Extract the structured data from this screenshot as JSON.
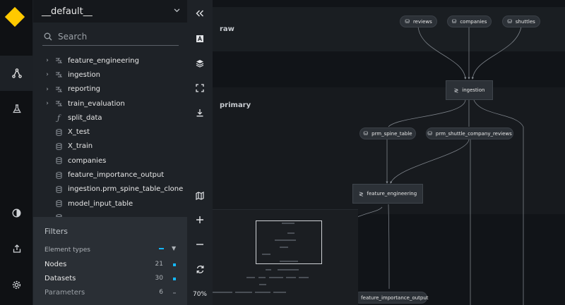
{
  "pipeline": {
    "name": "__default__"
  },
  "search": {
    "placeholder": "Search"
  },
  "tree": [
    {
      "label": "feature_engineering",
      "type": "modular",
      "expandable": true
    },
    {
      "label": "ingestion",
      "type": "modular",
      "expandable": true
    },
    {
      "label": "reporting",
      "type": "modular",
      "expandable": true
    },
    {
      "label": "train_evaluation",
      "type": "modular",
      "expandable": true
    },
    {
      "label": "split_data",
      "type": "task",
      "expandable": false
    },
    {
      "label": "X_test",
      "type": "dataset",
      "expandable": false
    },
    {
      "label": "X_train",
      "type": "dataset",
      "expandable": false
    },
    {
      "label": "companies",
      "type": "dataset",
      "expandable": false
    },
    {
      "label": "feature_importance_output",
      "type": "dataset",
      "expandable": false
    },
    {
      "label": "ingestion.prm_spine_table_clone",
      "type": "dataset",
      "expandable": false
    },
    {
      "label": "model_input_table",
      "type": "dataset",
      "expandable": false
    },
    {
      "label": "",
      "type": "dataset",
      "expandable": false
    }
  ],
  "filters": {
    "title": "Filters",
    "element_types": "Element types",
    "rows": [
      {
        "label": "Nodes",
        "count": "21",
        "enabled": true
      },
      {
        "label": "Datasets",
        "count": "30",
        "enabled": true
      },
      {
        "label": "Parameters",
        "count": "6",
        "enabled": false
      }
    ]
  },
  "toolbar": {
    "zoom": "70%"
  },
  "canvas": {
    "layers": {
      "raw": "raw",
      "primary": "primary"
    },
    "nodes": {
      "reviews": "reviews",
      "companies": "companies",
      "shuttles": "shuttles",
      "ingestion": "ingestion",
      "prm_spine_table": "prm_spine_table",
      "prm_shuttle_company_reviews": "prm_shuttle_company_reviews",
      "feature_engineering": "feature_engineering",
      "feature_importance_output": "feature_importance_output"
    }
  },
  "colors": {
    "accent": "#ffc900",
    "filter_on": "#14b8ff"
  }
}
